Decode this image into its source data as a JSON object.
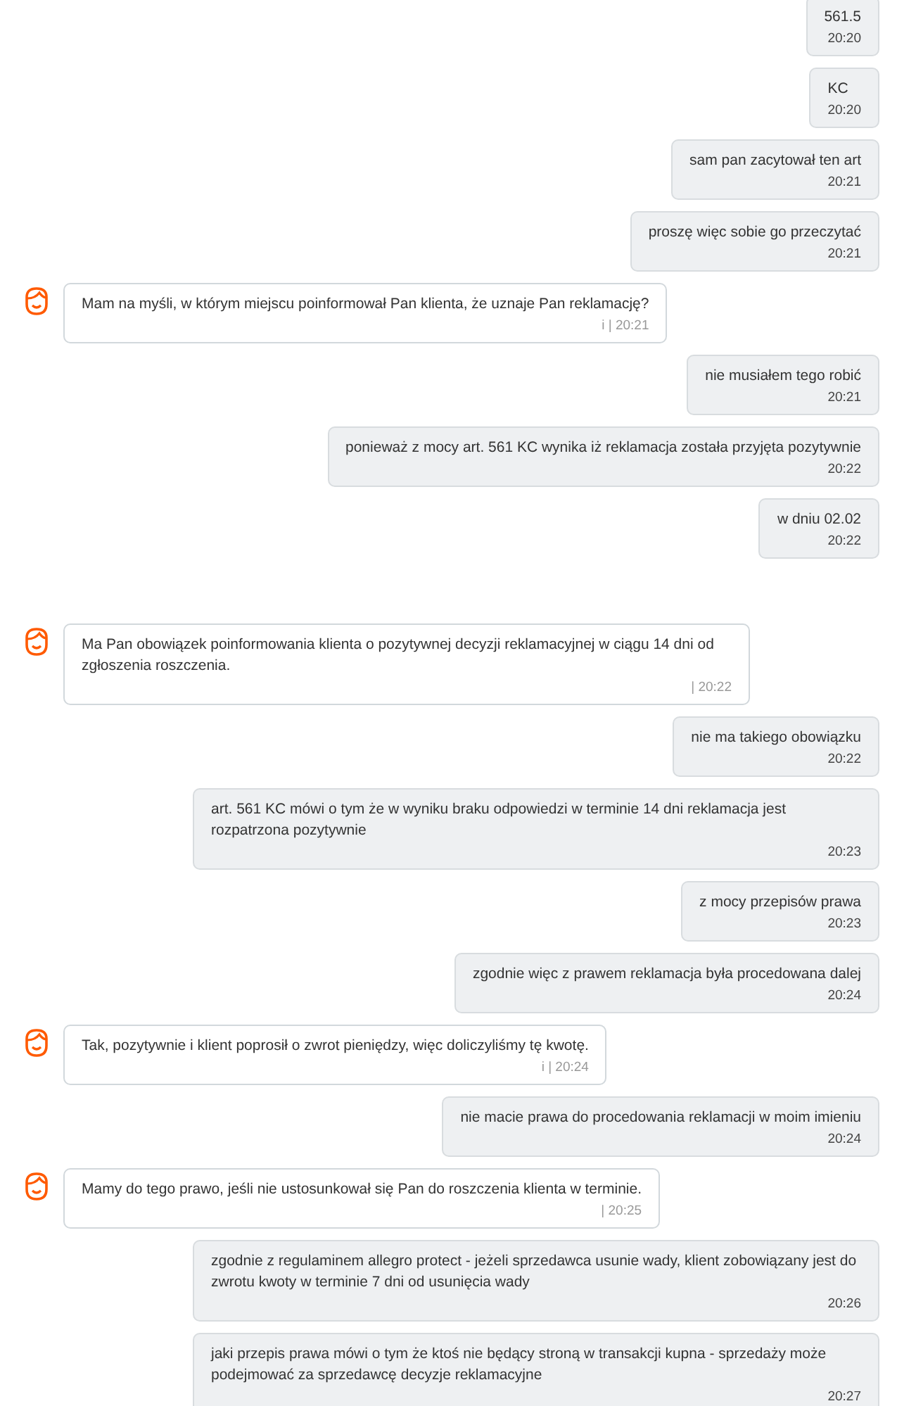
{
  "messages": [
    {
      "kind": "out",
      "text": "561.5",
      "time": "20:20"
    },
    {
      "kind": "out",
      "text": "KC",
      "time": "20:20"
    },
    {
      "kind": "out",
      "text": "sam pan zacytował ten art",
      "time": "20:21"
    },
    {
      "kind": "out",
      "text": "proszę więc sobie go przeczytać",
      "time": "20:21"
    },
    {
      "kind": "in",
      "text": "Mam na myśli, w którym miejscu poinformował Pan klienta, że uznaje Pan reklamację?",
      "time": "i | 20:21"
    },
    {
      "kind": "out",
      "text": "nie musiałem tego robić",
      "time": "20:21"
    },
    {
      "kind": "out",
      "text": "ponieważ z mocy art. 561 KC wynika iż reklamacja została przyjęta pozytywnie",
      "time": "20:22"
    },
    {
      "kind": "out",
      "text": "w dniu 02.02",
      "time": "20:22"
    },
    {
      "kind": "in",
      "text": "Ma Pan obowiązek poinformowania klienta o pozytywnej decyzji reklamacyjnej w ciągu 14 dni od zgłoszenia roszczenia.",
      "time": "| 20:22"
    },
    {
      "kind": "out",
      "text": "nie ma takiego obowiązku",
      "time": "20:22"
    },
    {
      "kind": "out",
      "text": "art. 561 KC mówi o tym że w wyniku braku odpowiedzi w terminie 14 dni reklamacja jest rozpatrzona pozytywnie",
      "time": "20:23"
    },
    {
      "kind": "out",
      "text": "z mocy przepisów prawa",
      "time": "20:23"
    },
    {
      "kind": "out",
      "text": "zgodnie więc z prawem reklamacja była procedowana dalej",
      "time": "20:24"
    },
    {
      "kind": "in",
      "text": "Tak, pozytywnie i klient poprosił o zwrot pieniędzy, więc doliczyliśmy tę kwotę.",
      "time": "i | 20:24"
    },
    {
      "kind": "out",
      "text": "nie macie prawa do procedowania reklamacji w moim imieniu",
      "time": "20:24"
    },
    {
      "kind": "in",
      "text": "Mamy do tego prawo, jeśli nie ustosunkował się Pan do roszczenia klienta w terminie.",
      "time": "| 20:25"
    },
    {
      "kind": "out",
      "text": "zgodnie z regulaminem allegro protect - jeżeli sprzedawca usunie wady, klient zobowiązany jest do zwrotu kwoty w terminie 7 dni od usunięcia wady",
      "time": "20:26"
    },
    {
      "kind": "out",
      "text": "jaki przepis prawa mówi o tym że ktoś nie będący stroną w transakcji kupna - sprzedaży może podejmować za sprzedawcę decyzje reklamacyjne",
      "time": "20:27"
    }
  ]
}
